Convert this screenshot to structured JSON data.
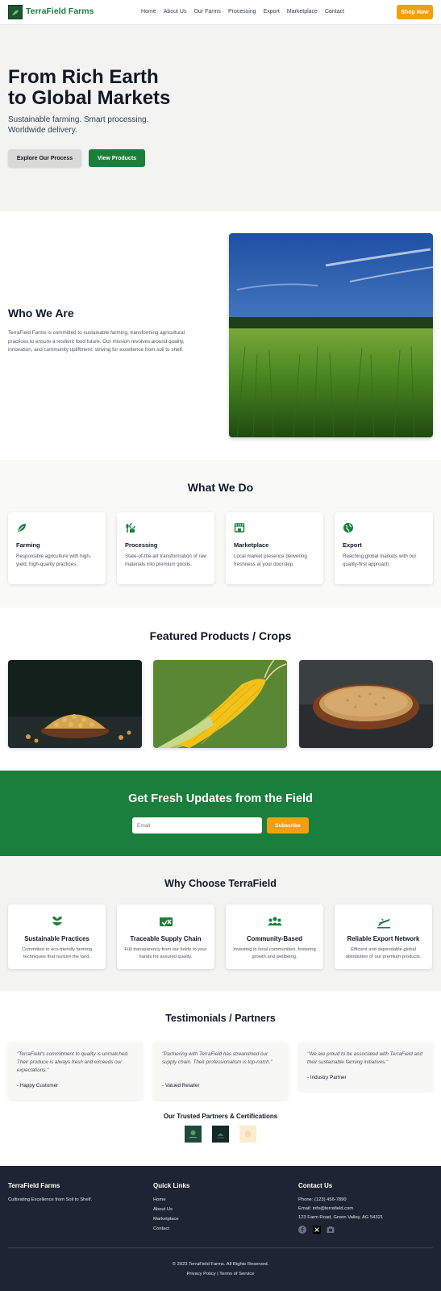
{
  "header": {
    "brand": "TerraField Farms",
    "nav": [
      "Home",
      "About Us",
      "Our Farms",
      "Processing",
      "Export",
      "Marketplace",
      "Contact"
    ],
    "shop_button": "Shop Now"
  },
  "hero": {
    "title_line1": "From Rich Earth",
    "title_line2": "to Global Markets",
    "subtitle_line1": "Sustainable farming. Smart processing.",
    "subtitle_line2": "Worldwide delivery.",
    "btn_explore": "Explore Our Process",
    "btn_products": "View Products"
  },
  "about": {
    "title": "Who We Are",
    "body": "TerraField Farms is committed to sustainable farming, transforming agricultural practices to ensure a resilient food future. Our mission revolves around quality, innovation, and community upliftment, striving for excellence from soil to shelf."
  },
  "services": {
    "title": "What We Do",
    "items": [
      {
        "icon": "leaf-icon",
        "title": "Farming",
        "desc": "Responsible agriculture with high-yield, high-quality practices."
      },
      {
        "icon": "crop-processing-icon",
        "title": "Processing",
        "desc": "State-of-the-art transformation of raw materials into premium goods."
      },
      {
        "icon": "storefront-icon",
        "title": "Marketplace",
        "desc": "Local market presence delivering freshness at your doorstep."
      },
      {
        "icon": "globe-icon",
        "title": "Export",
        "desc": "Reaching global markets with our quality-first approach."
      }
    ]
  },
  "featured": {
    "title": "Featured Products / Crops"
  },
  "newsletter": {
    "title": "Get Fresh Updates from the Field",
    "placeholder": "Email",
    "button": "Subscribe"
  },
  "why": {
    "title": "Why Choose TerraField",
    "items": [
      {
        "icon": "sprout-icon",
        "title": "Sustainable Practices",
        "desc": "Committed to eco-friendly farming techniques that nurture the land."
      },
      {
        "icon": "traceable-truck-icon",
        "title": "Traceable Supply Chain",
        "desc": "Full transparency from our fields to your hands for assured quality."
      },
      {
        "icon": "community-icon",
        "title": "Community-Based",
        "desc": "Investing in local communities, fostering growth and wellbeing."
      },
      {
        "icon": "airplane-icon",
        "title": "Reliable Export Network",
        "desc": "Efficient and dependable global distribution of our premium products."
      }
    ]
  },
  "testimonials": {
    "title": "Testimonials / Partners",
    "items": [
      {
        "quote": "\"TerraField's commitment to quality is unmatched. Their produce is always fresh and exceeds our expectations.\"",
        "author": "- Happy Customer"
      },
      {
        "quote": "\"Partnering with TerraField has streamlined our supply chain. Their professionalism is top-notch.\"",
        "author": "- Valued Retailer"
      },
      {
        "quote": "\"We are proud to be associated with TerraField and their sustainable farming initiatives.\"",
        "author": "- Industry Partner"
      }
    ],
    "partners_title": "Our Trusted Partners & Certifications"
  },
  "footer": {
    "brand": "TerraField Farms",
    "tagline": "Cultivating Excellence from Soil to Shelf.",
    "quick_links_title": "Quick Links",
    "links": [
      "Home",
      "About Us",
      "Marketplace",
      "Contact"
    ],
    "contact_title": "Contact Us",
    "phone": "Phone: (123) 456-7890",
    "email": "Email: info@terrafield.com",
    "address": "123 Farm Road, Green Valley, AG 54321",
    "copyright": "© 2023 TerraField Farms. All Rights Reserved.",
    "legal": "Privacy Policy | Terms of Service"
  },
  "colors": {
    "brand_green": "#1a7f3c",
    "accent_orange": "#f59e0b",
    "footer_bg": "#1e2433"
  }
}
